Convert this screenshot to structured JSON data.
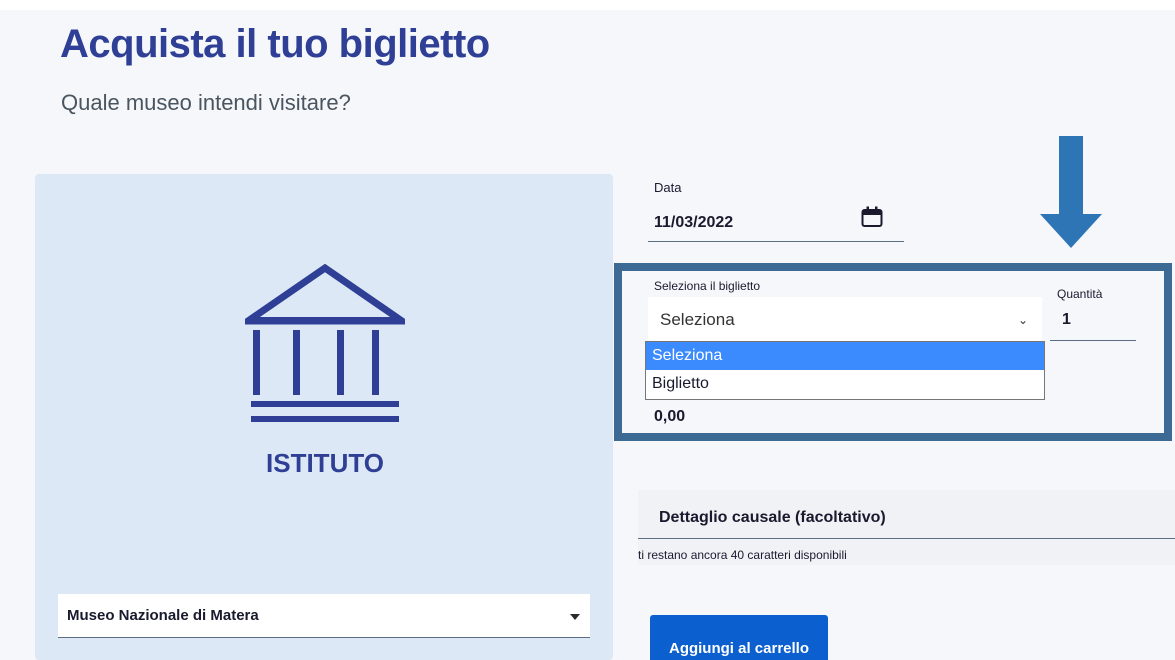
{
  "header": {
    "title": "Acquista il tuo biglietto",
    "subtitle": "Quale museo intendi visitare?"
  },
  "museum_card": {
    "icon": "institution-icon",
    "label": "ISTITUTO",
    "museum_select": {
      "selected": "Museo Nazionale di Matera"
    }
  },
  "form": {
    "date": {
      "label": "Data",
      "value": "11/03/2022",
      "icon": "calendar-icon"
    },
    "ticket": {
      "label": "Seleziona il biglietto",
      "selected": "Seleziona",
      "options": [
        "Seleziona",
        "Biglietto"
      ]
    },
    "quantity": {
      "label": "Quantità",
      "value": "1"
    },
    "price": "0,00",
    "causale": {
      "label": "Dettaglio causale (facoltativo)",
      "hint": "ti restano ancora 40 caratteri disponibili"
    },
    "add_to_cart_label": "Aggiungi al carrello"
  },
  "annotation": {
    "arrow_color": "#2e75b6",
    "highlight_color": "#3c6a94"
  },
  "colors": {
    "brand": "#2e3f95",
    "primary_button": "#0b5fcf",
    "selected_option": "#3b8bff"
  }
}
